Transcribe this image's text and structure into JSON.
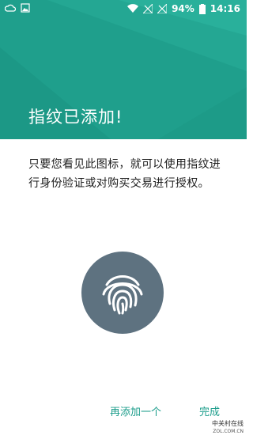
{
  "status_bar": {
    "battery": "94%",
    "time": "14:16"
  },
  "colors": {
    "header": "#1f9f8c",
    "accent": "#1a9c8a",
    "fingerprint_circle": "#5e7280"
  },
  "header": {
    "title": "指纹已添加!"
  },
  "body": {
    "description": "只要您看见此图标，就可以使用指纹进行身份验证或对购买交易进行授权。"
  },
  "icons": {
    "fingerprint": "fingerprint-icon"
  },
  "actions": {
    "add_another": "再添加一个",
    "done": "完成"
  },
  "watermark": {
    "line1": "中关村在线",
    "line2": "ZOL.COM.CN"
  }
}
